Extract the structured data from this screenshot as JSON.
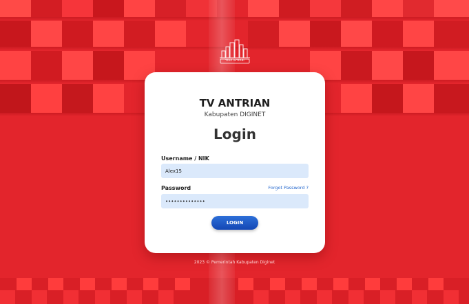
{
  "app": {
    "title": "TV ANTRIAN",
    "subtitle": "Kabupaten DIGINET",
    "logo_text": "TEKO INTERBI"
  },
  "form": {
    "heading": "Login",
    "username_label": "Username / NIK",
    "username_value": "Alex15",
    "password_label": "Password",
    "password_value": "••••••••••••••",
    "forgot_label": "Forgot Password ?",
    "submit_label": "LOGIN"
  },
  "footer": {
    "text": "2023 © Pemerintah Kabupaten Diginet"
  },
  "colors": {
    "background": "#e3252c",
    "card": "#ffffff",
    "input_bg": "#dbe9fb",
    "button": "#1f5bc8",
    "link": "#2266cc"
  }
}
